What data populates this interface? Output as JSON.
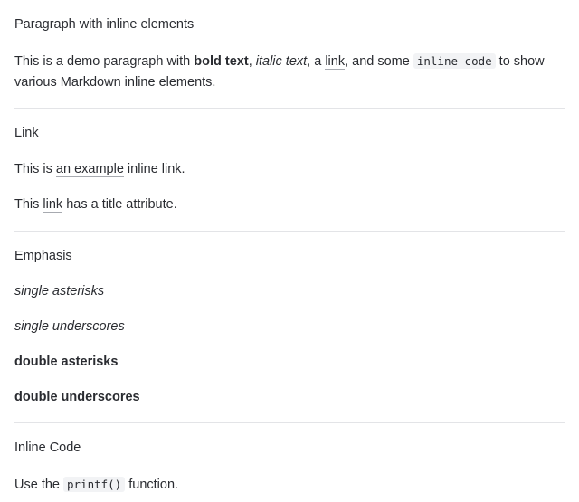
{
  "sections": {
    "paragraph": {
      "title": "Paragraph with inline elements",
      "text_1": "This is a demo paragraph with ",
      "bold": "bold text",
      "text_2": ", ",
      "italic": "italic text",
      "text_3": ", a ",
      "link": "link",
      "text_4": ", and some ",
      "code": "inline code",
      "text_5": " to show various Markdown inline elements."
    },
    "link": {
      "title": "Link",
      "p1_before": "This is ",
      "p1_link": "an example",
      "p1_after": " inline link.",
      "p2_before": "This ",
      "p2_link": "link",
      "p2_after": " has a title attribute."
    },
    "emphasis": {
      "title": "Emphasis",
      "single_asterisks": "single asterisks",
      "single_underscores": "single underscores",
      "double_asterisks": "double asterisks",
      "double_underscores": "double underscores"
    },
    "inline_code": {
      "title": "Inline Code",
      "before": "Use the ",
      "code": "printf()",
      "after": " function."
    }
  }
}
